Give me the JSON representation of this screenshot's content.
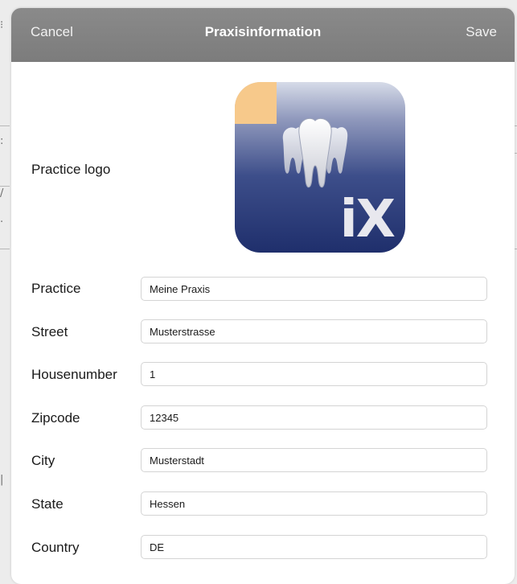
{
  "navbar": {
    "cancel_label": "Cancel",
    "title": "Praxisinformation",
    "save_label": "Save"
  },
  "logo": {
    "label": "Practice logo",
    "text": "iX",
    "icon": "tooth-icon",
    "colors": {
      "corner": "#f7c98b",
      "top": "#d6dbe8",
      "bottom": "#1f2f6c"
    }
  },
  "form": {
    "fields": [
      {
        "label": "Practice",
        "value": "Meine Praxis"
      },
      {
        "label": "Street",
        "value": "Musterstrasse"
      },
      {
        "label": "Housenumber",
        "value": "1"
      },
      {
        "label": "Zipcode",
        "value": "12345"
      },
      {
        "label": "City",
        "value": "Musterstadt"
      },
      {
        "label": "State",
        "value": "Hessen"
      },
      {
        "label": "Country",
        "value": "DE"
      }
    ]
  },
  "colors": {
    "navbar": "#848484",
    "field_border": "#d4d4d4"
  }
}
